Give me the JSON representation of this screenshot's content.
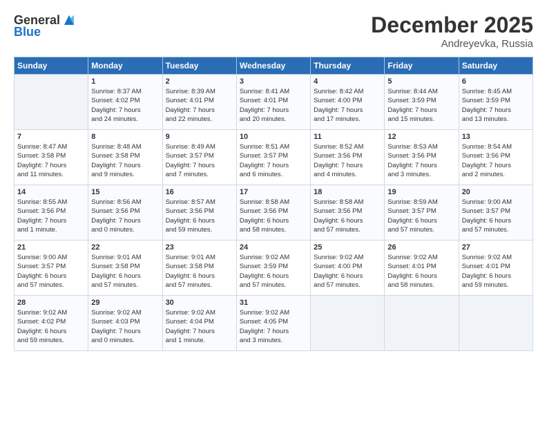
{
  "header": {
    "logo_general": "General",
    "logo_blue": "Blue",
    "month_year": "December 2025",
    "location": "Andreyevka, Russia"
  },
  "columns": [
    "Sunday",
    "Monday",
    "Tuesday",
    "Wednesday",
    "Thursday",
    "Friday",
    "Saturday"
  ],
  "weeks": [
    [
      {
        "day": "",
        "info": ""
      },
      {
        "day": "1",
        "info": "Sunrise: 8:37 AM\nSunset: 4:02 PM\nDaylight: 7 hours\nand 24 minutes."
      },
      {
        "day": "2",
        "info": "Sunrise: 8:39 AM\nSunset: 4:01 PM\nDaylight: 7 hours\nand 22 minutes."
      },
      {
        "day": "3",
        "info": "Sunrise: 8:41 AM\nSunset: 4:01 PM\nDaylight: 7 hours\nand 20 minutes."
      },
      {
        "day": "4",
        "info": "Sunrise: 8:42 AM\nSunset: 4:00 PM\nDaylight: 7 hours\nand 17 minutes."
      },
      {
        "day": "5",
        "info": "Sunrise: 8:44 AM\nSunset: 3:59 PM\nDaylight: 7 hours\nand 15 minutes."
      },
      {
        "day": "6",
        "info": "Sunrise: 8:45 AM\nSunset: 3:59 PM\nDaylight: 7 hours\nand 13 minutes."
      }
    ],
    [
      {
        "day": "7",
        "info": "Sunrise: 8:47 AM\nSunset: 3:58 PM\nDaylight: 7 hours\nand 11 minutes."
      },
      {
        "day": "8",
        "info": "Sunrise: 8:48 AM\nSunset: 3:58 PM\nDaylight: 7 hours\nand 9 minutes."
      },
      {
        "day": "9",
        "info": "Sunrise: 8:49 AM\nSunset: 3:57 PM\nDaylight: 7 hours\nand 7 minutes."
      },
      {
        "day": "10",
        "info": "Sunrise: 8:51 AM\nSunset: 3:57 PM\nDaylight: 7 hours\nand 6 minutes."
      },
      {
        "day": "11",
        "info": "Sunrise: 8:52 AM\nSunset: 3:56 PM\nDaylight: 7 hours\nand 4 minutes."
      },
      {
        "day": "12",
        "info": "Sunrise: 8:53 AM\nSunset: 3:56 PM\nDaylight: 7 hours\nand 3 minutes."
      },
      {
        "day": "13",
        "info": "Sunrise: 8:54 AM\nSunset: 3:56 PM\nDaylight: 7 hours\nand 2 minutes."
      }
    ],
    [
      {
        "day": "14",
        "info": "Sunrise: 8:55 AM\nSunset: 3:56 PM\nDaylight: 7 hours\nand 1 minute."
      },
      {
        "day": "15",
        "info": "Sunrise: 8:56 AM\nSunset: 3:56 PM\nDaylight: 7 hours\nand 0 minutes."
      },
      {
        "day": "16",
        "info": "Sunrise: 8:57 AM\nSunset: 3:56 PM\nDaylight: 6 hours\nand 59 minutes."
      },
      {
        "day": "17",
        "info": "Sunrise: 8:58 AM\nSunset: 3:56 PM\nDaylight: 6 hours\nand 58 minutes."
      },
      {
        "day": "18",
        "info": "Sunrise: 8:58 AM\nSunset: 3:56 PM\nDaylight: 6 hours\nand 57 minutes."
      },
      {
        "day": "19",
        "info": "Sunrise: 8:59 AM\nSunset: 3:57 PM\nDaylight: 6 hours\nand 57 minutes."
      },
      {
        "day": "20",
        "info": "Sunrise: 9:00 AM\nSunset: 3:57 PM\nDaylight: 6 hours\nand 57 minutes."
      }
    ],
    [
      {
        "day": "21",
        "info": "Sunrise: 9:00 AM\nSunset: 3:57 PM\nDaylight: 6 hours\nand 57 minutes."
      },
      {
        "day": "22",
        "info": "Sunrise: 9:01 AM\nSunset: 3:58 PM\nDaylight: 6 hours\nand 57 minutes."
      },
      {
        "day": "23",
        "info": "Sunrise: 9:01 AM\nSunset: 3:58 PM\nDaylight: 6 hours\nand 57 minutes."
      },
      {
        "day": "24",
        "info": "Sunrise: 9:02 AM\nSunset: 3:59 PM\nDaylight: 6 hours\nand 57 minutes."
      },
      {
        "day": "25",
        "info": "Sunrise: 9:02 AM\nSunset: 4:00 PM\nDaylight: 6 hours\nand 57 minutes."
      },
      {
        "day": "26",
        "info": "Sunrise: 9:02 AM\nSunset: 4:01 PM\nDaylight: 6 hours\nand 58 minutes."
      },
      {
        "day": "27",
        "info": "Sunrise: 9:02 AM\nSunset: 4:01 PM\nDaylight: 6 hours\nand 59 minutes."
      }
    ],
    [
      {
        "day": "28",
        "info": "Sunrise: 9:02 AM\nSunset: 4:02 PM\nDaylight: 6 hours\nand 59 minutes."
      },
      {
        "day": "29",
        "info": "Sunrise: 9:02 AM\nSunset: 4:03 PM\nDaylight: 7 hours\nand 0 minutes."
      },
      {
        "day": "30",
        "info": "Sunrise: 9:02 AM\nSunset: 4:04 PM\nDaylight: 7 hours\nand 1 minute."
      },
      {
        "day": "31",
        "info": "Sunrise: 9:02 AM\nSunset: 4:05 PM\nDaylight: 7 hours\nand 3 minutes."
      },
      {
        "day": "",
        "info": ""
      },
      {
        "day": "",
        "info": ""
      },
      {
        "day": "",
        "info": ""
      }
    ]
  ]
}
